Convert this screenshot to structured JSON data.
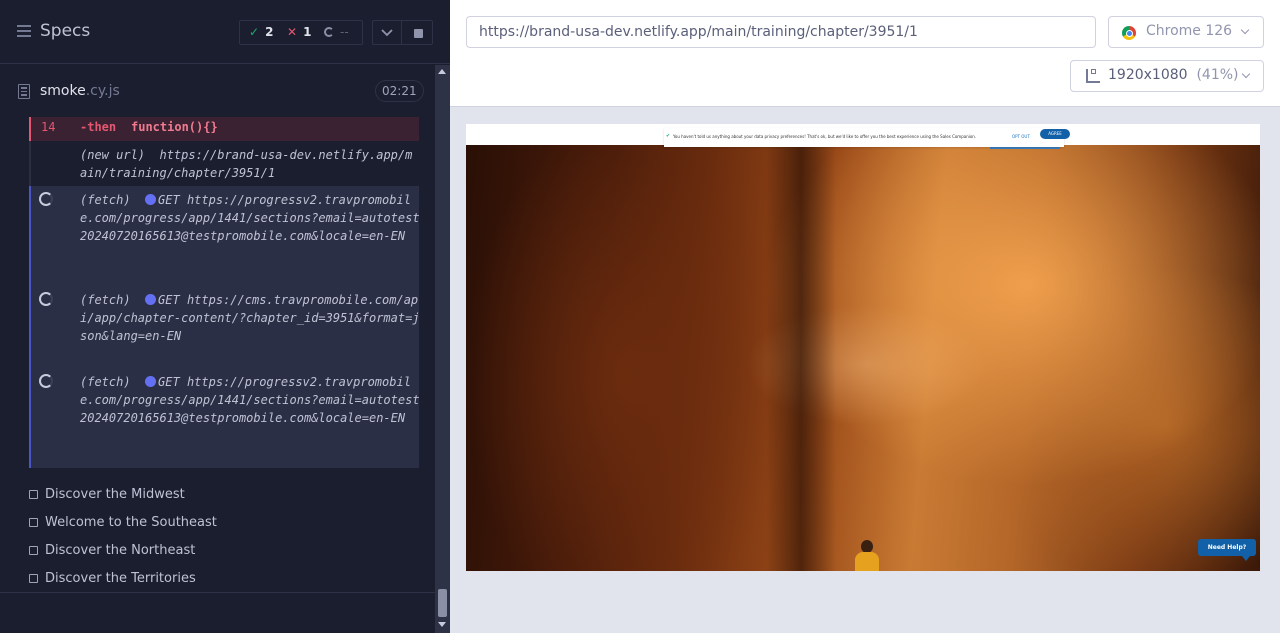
{
  "specs": {
    "title": "Specs",
    "stats": {
      "passed": "2",
      "failed": "1",
      "pending": "--"
    }
  },
  "file": {
    "name": "smoke",
    "ext": ".cy.js",
    "duration": "02:21"
  },
  "commands": {
    "then": {
      "number": "14",
      "name": "-then",
      "message": "function(){}"
    },
    "new_url": {
      "label": "(new url)",
      "url": "https://brand-usa-dev.netlify.app/main/training/chapter/3951/1"
    },
    "fetches": [
      {
        "label": "(fetch)",
        "method": "GET",
        "url": "https://progressv2.travpromobile.com/progress/app/1441/sections?email=autotest20240720165613@testpromobile.com&locale=en-EN"
      },
      {
        "label": "(fetch)",
        "method": "GET",
        "url": "https://cms.travpromobile.com/api/app/chapter-content/?chapter_id=3951&format=json&lang=en-EN"
      },
      {
        "label": "(fetch)",
        "method": "GET",
        "url": "https://progressv2.travpromobile.com/progress/app/1441/sections?email=autotest20240720165613@testpromobile.com&locale=en-EN"
      }
    ]
  },
  "tests": [
    {
      "label": "Discover the Midwest"
    },
    {
      "label": "Welcome to the Southeast"
    },
    {
      "label": "Discover the Northeast"
    },
    {
      "label": "Discover the Territories"
    }
  ],
  "aut": {
    "url": "https://brand-usa-dev.netlify.app/main/training/chapter/3951/1",
    "browser": "Chrome 126",
    "viewport": "1920x1080",
    "scale": "(41%)"
  },
  "page": {
    "cookie_text": "You haven't told us anything about your data privacy preferences! That's ok, but we'd like to offer you the best experience using the Sales Companion.",
    "opt_out": "OPT OUT",
    "agree": "AGREE",
    "need_help": "Need Help?"
  },
  "colors": {
    "pass": "#1fa971",
    "fail": "#e45770",
    "fetch_dot": "#6470f3",
    "brand_blue": "#1261a8"
  }
}
